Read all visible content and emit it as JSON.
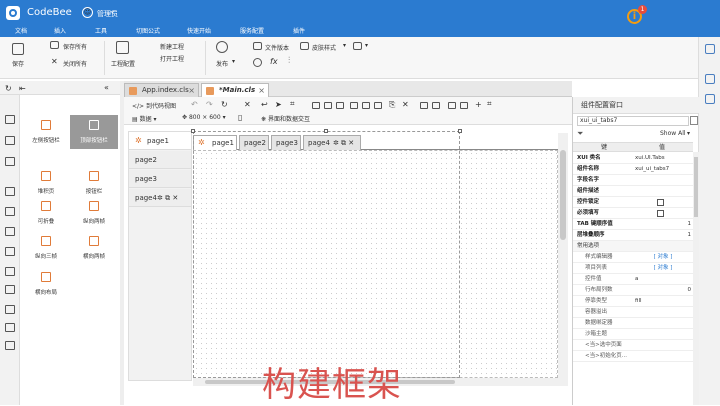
{
  "app": {
    "title": "CodeBee",
    "user": "管理员",
    "info_badge": "1",
    "accent": "#2b7bd0"
  },
  "menu": [
    "文档",
    "插入",
    "工具",
    "切图公式",
    "快速开始",
    "服务配置",
    "插件"
  ],
  "ribbon": {
    "save": "保存",
    "save_all": "保存所有",
    "close_all": "关闭所有",
    "project_config": "工程配置",
    "new_project": "新建工程",
    "open_project": "打开工程",
    "publish": "发布",
    "file_version": "文件版本",
    "skin_style": "皮肤样式",
    "fx": "fx"
  },
  "file_tabs": [
    {
      "label": "App.index.cls"
    },
    {
      "label": "*Main.cls"
    }
  ],
  "editor_toolbar": {
    "to_code": "到代码视图",
    "data": "数据",
    "size": "800 × 600",
    "interface_data": "界面和数据交互"
  },
  "palette": [
    {
      "label": "左侧按钮栏"
    },
    {
      "label": "顶部按钮栏"
    },
    {
      "label": "堆积页"
    },
    {
      "label": "按钮栏"
    },
    {
      "label": "可折叠"
    },
    {
      "label": "纵向两帧"
    },
    {
      "label": "纵向三帧"
    },
    {
      "label": "横向两帧"
    },
    {
      "label": "横向布局"
    }
  ],
  "vertical_tabs": [
    "page1",
    "page2",
    "page3",
    "page4"
  ],
  "inner_tabs": [
    "page1",
    "page2",
    "page3",
    "page4"
  ],
  "overlay_text": "构建框架",
  "properties": {
    "title": "组件配置窗口",
    "search_value": "xui_ui_tabs7",
    "show_all": "Show All",
    "header_key": "键",
    "header_value": "值",
    "rows": [
      {
        "k": "XUI 类名",
        "v": "xui.UI.Tabs",
        "style": "b"
      },
      {
        "k": "组件名称",
        "v": "xui_ui_tabs7",
        "style": "b"
      },
      {
        "k": "字段名字",
        "v": "",
        "style": "b"
      },
      {
        "k": "组件描述",
        "v": "",
        "style": "b"
      },
      {
        "k": "控件锁定",
        "v": "",
        "style": "b",
        "cb": true
      },
      {
        "k": "必须填写",
        "v": "",
        "style": "b",
        "cb": true
      },
      {
        "k": "TAB 键顺序值",
        "v": "1",
        "style": "b"
      },
      {
        "k": "层堆叠顺序",
        "v": "1",
        "style": "b"
      },
      {
        "k": "常用选项",
        "v": "",
        "style": "sec"
      },
      {
        "k": "样式编辑器",
        "v": "[ 对象 ]",
        "style": "sub"
      },
      {
        "k": "项目列表",
        "v": "[ 对象 ]",
        "style": "sub"
      },
      {
        "k": "控件值",
        "v": "a",
        "style": "sub"
      },
      {
        "k": "行布局列数",
        "v": "0",
        "style": "sub"
      },
      {
        "k": "停靠类型",
        "v": "fill",
        "style": "sub"
      },
      {
        "k": "容器溢出",
        "v": "",
        "style": "sub"
      },
      {
        "k": "数据绑定器",
        "v": "",
        "style": "sub"
      },
      {
        "k": "沙箱主题",
        "v": "",
        "style": "sub"
      },
      {
        "k": "<当>选中页面",
        "v": "",
        "style": "sub"
      },
      {
        "k": "<当>初始化页...",
        "v": "",
        "style": "sub"
      }
    ]
  }
}
